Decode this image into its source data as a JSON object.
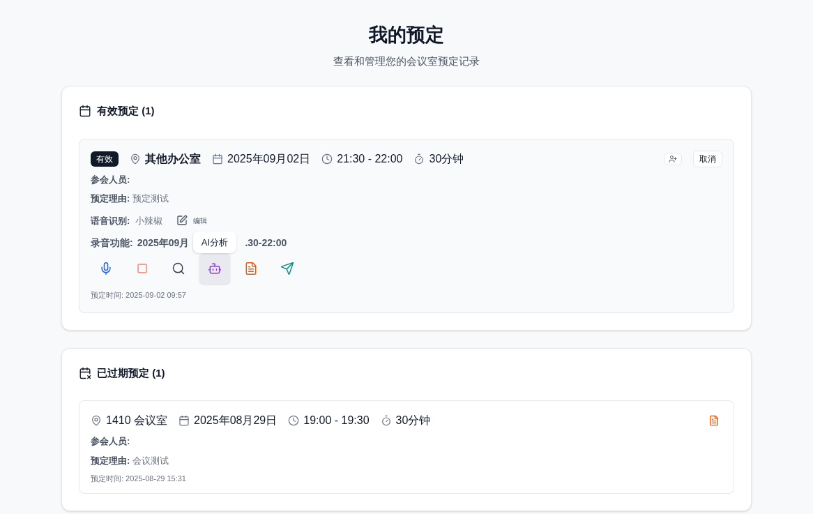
{
  "header": {
    "title": "我的预定",
    "subtitle": "查看和管理您的会议室预定记录"
  },
  "sections": [
    {
      "kind": "active",
      "title": "有效预定 (1)",
      "bookings": [
        {
          "status": "有效",
          "room": "其他办公室",
          "date": "2025年09月02日",
          "time": "21:30 - 22:00",
          "duration": "30分钟",
          "header_actions": [
            {
              "kind": "add-person"
            },
            {
              "kind": "text",
              "label": "取消"
            }
          ],
          "attendees_label": "参会人员:",
          "reason_label": "预定理由:",
          "reason": "预定测试",
          "voice": {
            "label": "语音识别:",
            "value": "小辣椒",
            "edit_label": "编辑"
          },
          "recording": {
            "label": "录音功能:",
            "value_start": "2025年09月",
            "value_end": ".30-22:00"
          },
          "actions": [
            {
              "kind": "mic",
              "color": "#2563eb",
              "selected": false
            },
            {
              "kind": "stop",
              "color": "#f0a08a",
              "selected": false
            },
            {
              "kind": "search",
              "color": "#374151",
              "selected": false
            },
            {
              "kind": "bot",
              "color": "#9333ea",
              "selected": true,
              "tooltip": "AI分析"
            },
            {
              "kind": "file",
              "color": "#ea580c",
              "selected": false
            },
            {
              "kind": "send",
              "color": "#0d9488",
              "selected": false
            }
          ],
          "booked_at": "预定时间: 2025-09-02 09:57"
        }
      ]
    },
    {
      "kind": "expired",
      "title": "已过期预定 (1)",
      "bookings": [
        {
          "room": "1410 会议室",
          "date": "2025年08月29日",
          "time": "19:00 - 19:30",
          "duration": "30分钟",
          "header_actions": [
            {
              "kind": "file"
            }
          ],
          "attendees_label": "参会人员:",
          "reason_label": "预定理由:",
          "reason": "会议测试",
          "booked_at": "预定时间: 2025-08-29 15:31"
        }
      ]
    }
  ]
}
